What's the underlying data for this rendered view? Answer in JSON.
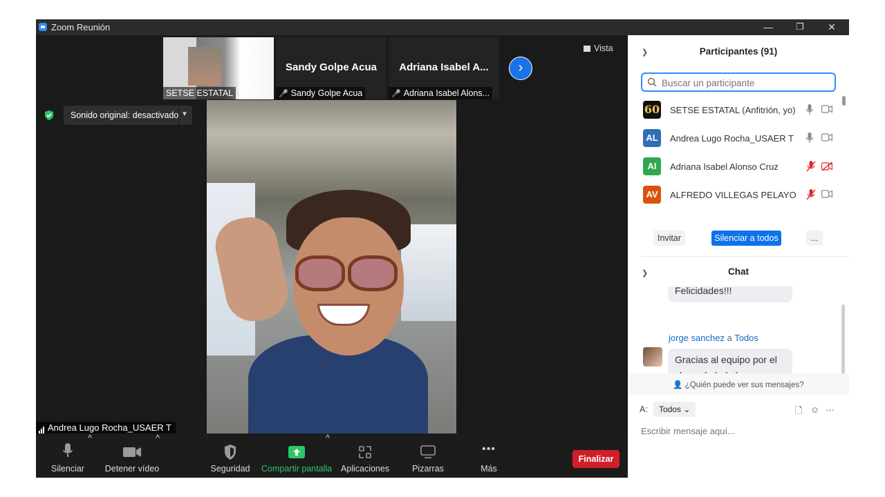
{
  "window": {
    "title": "Zoom Reunión",
    "minimize": "—",
    "restore": "❐",
    "close": "✕"
  },
  "thumbnails": [
    {
      "name": "SETSE ESTATAL"
    },
    {
      "display": "Sandy Golpe Acua",
      "name": "Sandy Golpe Acua"
    },
    {
      "display": "Adriana Isabel A...",
      "name": "Adriana Isabel Alons..."
    }
  ],
  "view": {
    "label": "Vista"
  },
  "sound": {
    "label": "Sonido original: desactivado"
  },
  "active_speaker": {
    "name": "Andrea Lugo Rocha_USAER T"
  },
  "toolbar": {
    "mute": "Silenciar",
    "stop_video": "Detener vídeo",
    "security": "Seguridad",
    "share": "Compartir pantalla",
    "apps": "Aplicaciones",
    "whiteboards": "Pizarras",
    "more": "Más",
    "end": "Finalizar"
  },
  "participants": {
    "title": "Participantes (91)",
    "search_placeholder": "Buscar un participante",
    "items": [
      {
        "initials": "60",
        "name": "SETSE ESTATAL (Anfitrión, yo)",
        "color": "#111111",
        "muted": false,
        "video_off": false
      },
      {
        "initials": "AL",
        "name": "Andrea Lugo Rocha_USAER T",
        "color": "#2e6fb5",
        "muted": false,
        "video_off": false
      },
      {
        "initials": "AI",
        "name": "Adriana Isabel Alonso Cruz",
        "color": "#2fa84f",
        "muted": true,
        "video_off": true
      },
      {
        "initials": "AV",
        "name": "ALFREDO VILLEGAS PELAYO",
        "color": "#d9530f",
        "muted": true,
        "video_off": false
      }
    ],
    "invite": "Invitar",
    "mute_all": "Silenciar a todos",
    "more": "..."
  },
  "chat": {
    "title": "Chat",
    "prev_message": "Felicidades!!!",
    "sender": "jorge sanchez",
    "to_word": "a",
    "recipient": "Todos",
    "message_line1": "Gracias al equipo por el",
    "message_line2": "show",
    "emoji": "👍🏽👍🏽👍🏽👍🏽",
    "who_can_see": "¿Quién puede ver sus mensajes?",
    "to_label": "A:",
    "to_value": "Todos",
    "input_placeholder": "Escribir mensaje aquí..."
  },
  "colors": {
    "accent": "#2d8cff",
    "end": "#d11f29",
    "share": "#2ec56a"
  }
}
